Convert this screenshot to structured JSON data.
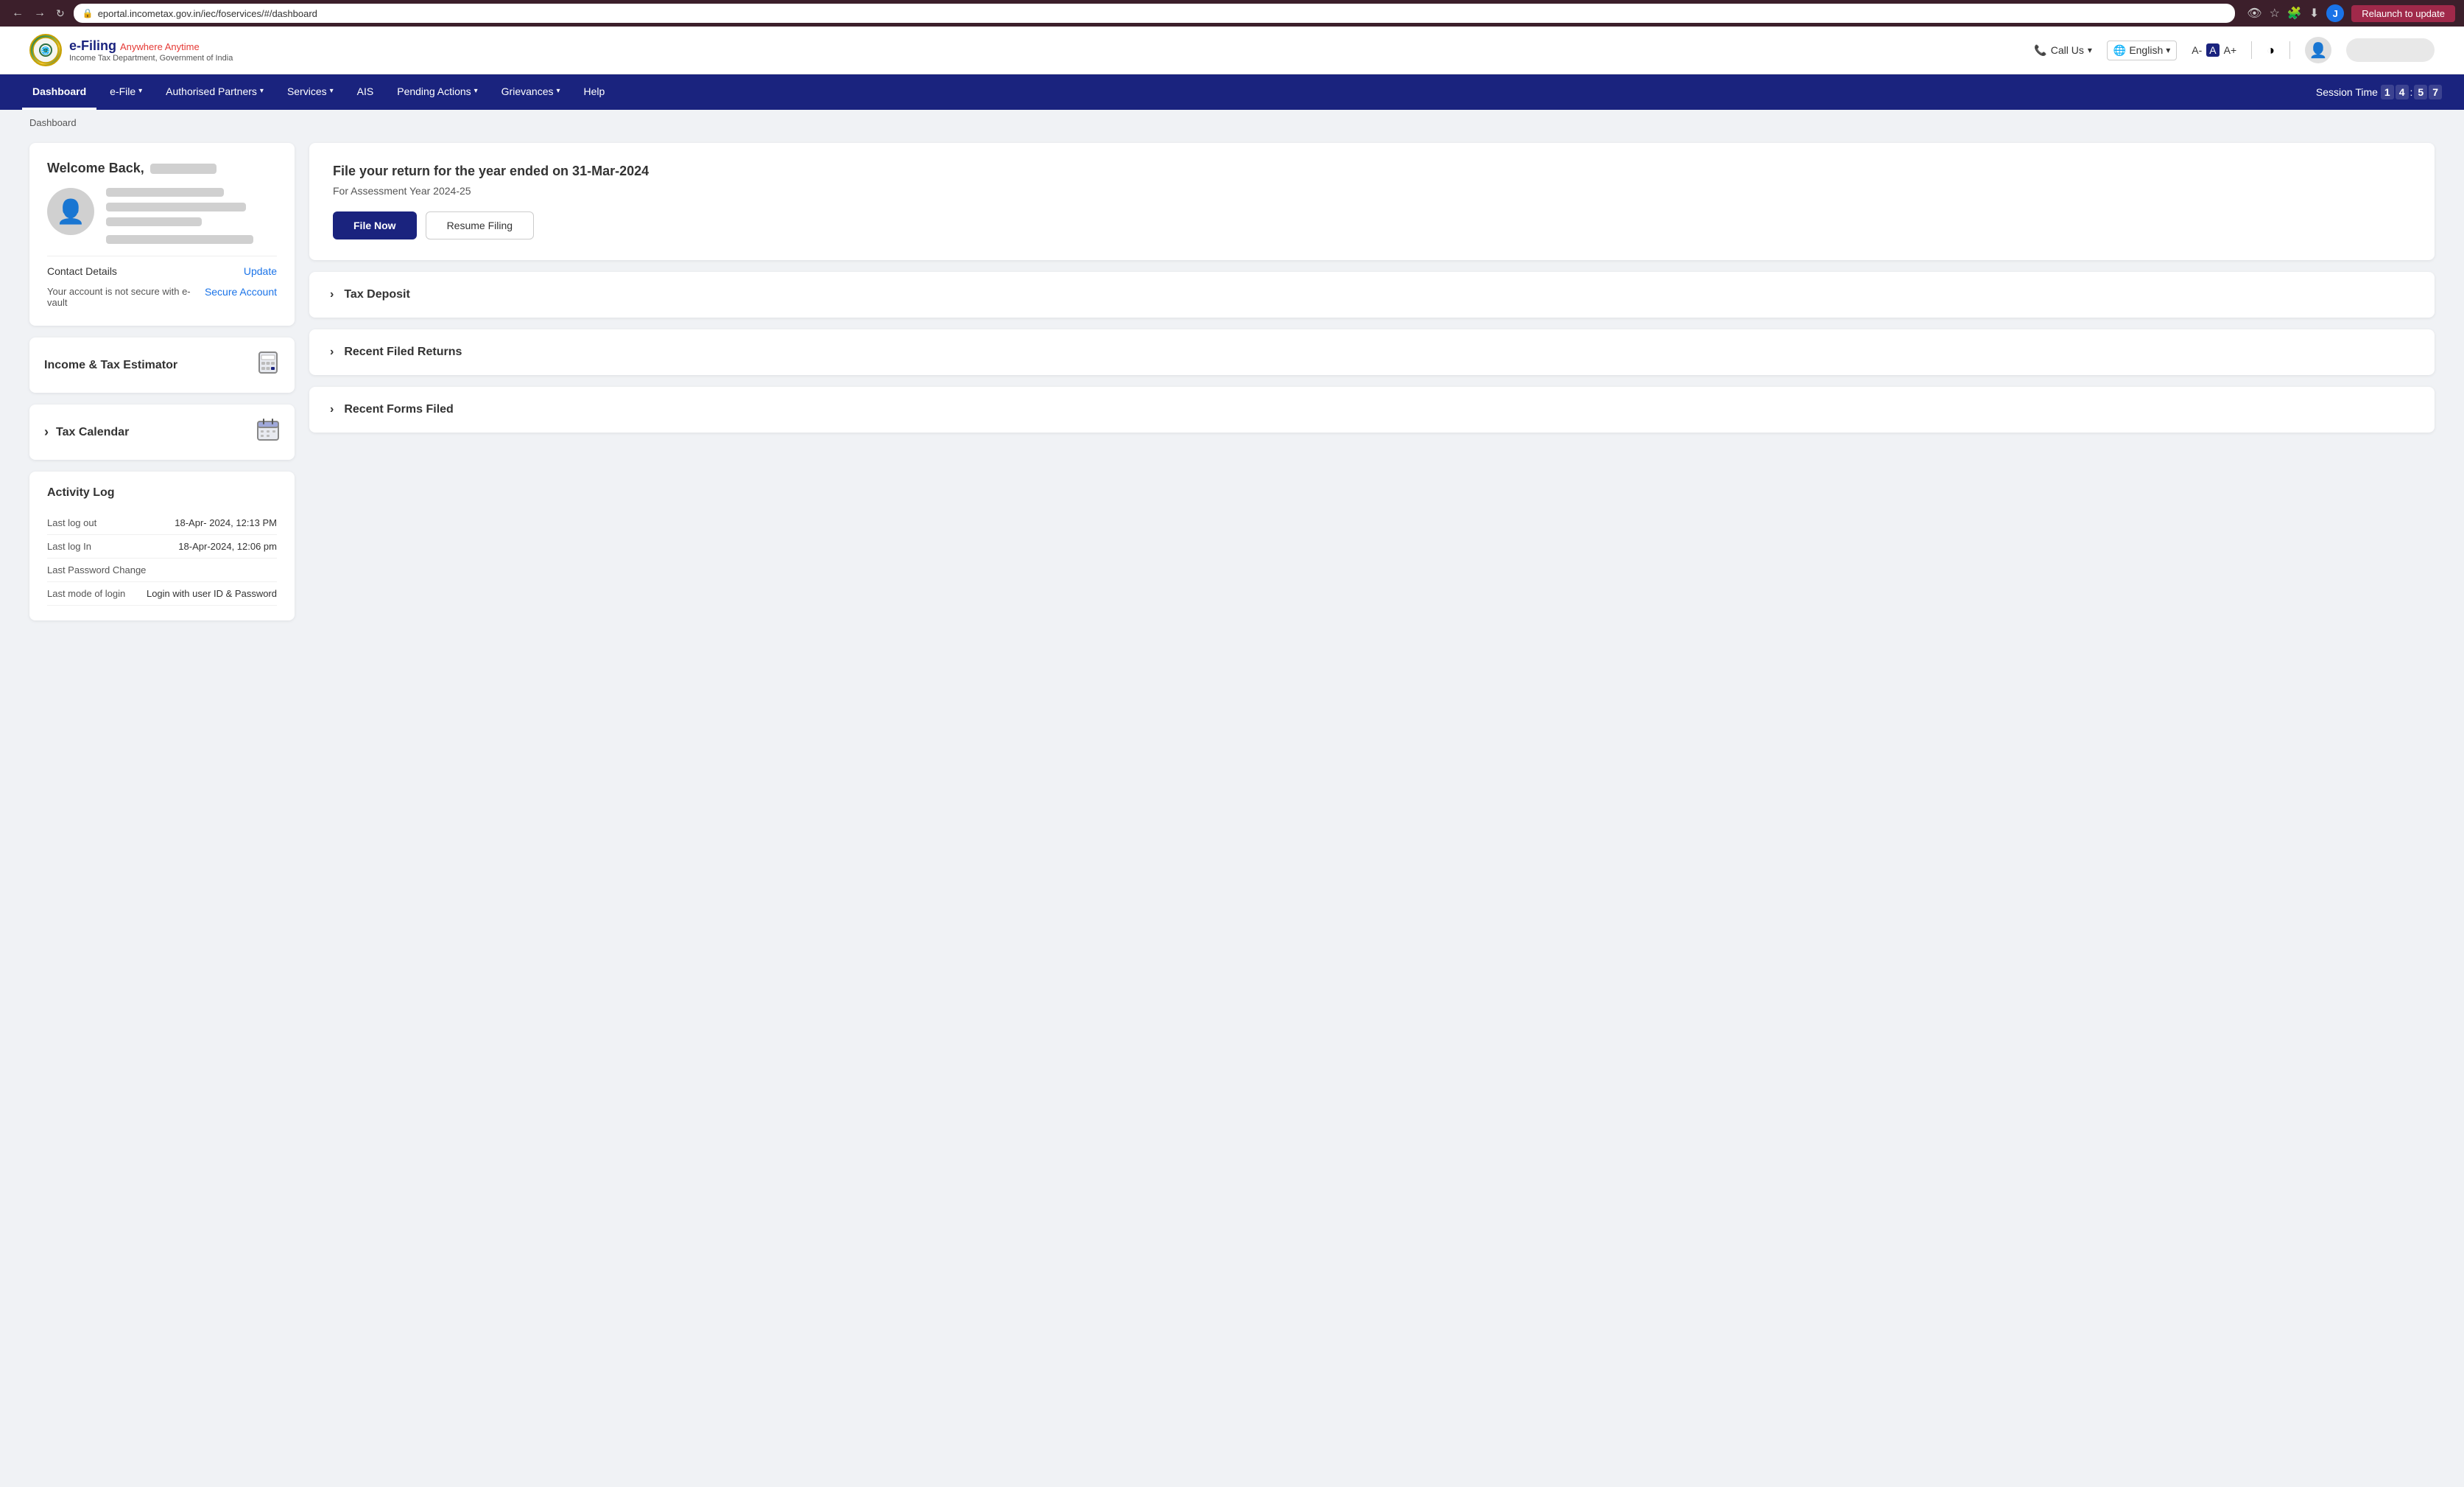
{
  "browser": {
    "url": "eportal.incometax.gov.in/iec/foservices/#/dashboard",
    "relaunch_label": "Relaunch to update"
  },
  "header": {
    "logo_emblem": "🇮🇳",
    "logo_title": "e-Filing",
    "logo_tagline": "Anywhere Anytime",
    "logo_subtitle": "Income Tax Department, Government of India",
    "call_us": "Call Us",
    "language": "English",
    "font_smaller": "A-",
    "font_normal": "A",
    "font_larger": "A+",
    "contrast_icon": "◑"
  },
  "nav": {
    "items": [
      {
        "label": "Dashboard",
        "active": true,
        "has_dropdown": false
      },
      {
        "label": "e-File",
        "active": false,
        "has_dropdown": true
      },
      {
        "label": "Authorised Partners",
        "active": false,
        "has_dropdown": true
      },
      {
        "label": "Services",
        "active": false,
        "has_dropdown": true
      },
      {
        "label": "AIS",
        "active": false,
        "has_dropdown": false
      },
      {
        "label": "Pending Actions",
        "active": false,
        "has_dropdown": true
      },
      {
        "label": "Grievances",
        "active": false,
        "has_dropdown": true
      },
      {
        "label": "Help",
        "active": false,
        "has_dropdown": false
      }
    ],
    "session_label": "Session Time",
    "session_time": {
      "h1": "1",
      "h2": "4",
      "sep": ":",
      "m1": "5",
      "m2": "7"
    }
  },
  "breadcrumb": "Dashboard",
  "welcome": {
    "title": "Welcome Back,",
    "contact_label": "Contact Details",
    "update_label": "Update",
    "secure_text": "Your account is not secure with e-vault",
    "secure_link": "Secure Account"
  },
  "estimator": {
    "title": "Income & Tax Estimator"
  },
  "tax_calendar": {
    "title": "Tax Calendar",
    "chevron": "›"
  },
  "activity_log": {
    "title": "Activity Log",
    "rows": [
      {
        "label": "Last log out",
        "value": "18-Apr- 2024, 12:13 PM"
      },
      {
        "label": "Last log In",
        "value": "18-Apr-2024, 12:06 pm"
      },
      {
        "label": "Last Password Change",
        "value": ""
      },
      {
        "label": "Last mode of login",
        "value": "Login with user ID & Password"
      }
    ]
  },
  "file_return": {
    "title": "File your return for the year ended on 31-Mar-2024",
    "subtitle": "For Assessment Year 2024-25",
    "file_now": "File Now",
    "resume_filing": "Resume Filing"
  },
  "tax_deposit": {
    "title": "Tax Deposit"
  },
  "recent_filed": {
    "title": "Recent Filed Returns"
  },
  "recent_forms": {
    "title": "Recent Forms Filed"
  }
}
